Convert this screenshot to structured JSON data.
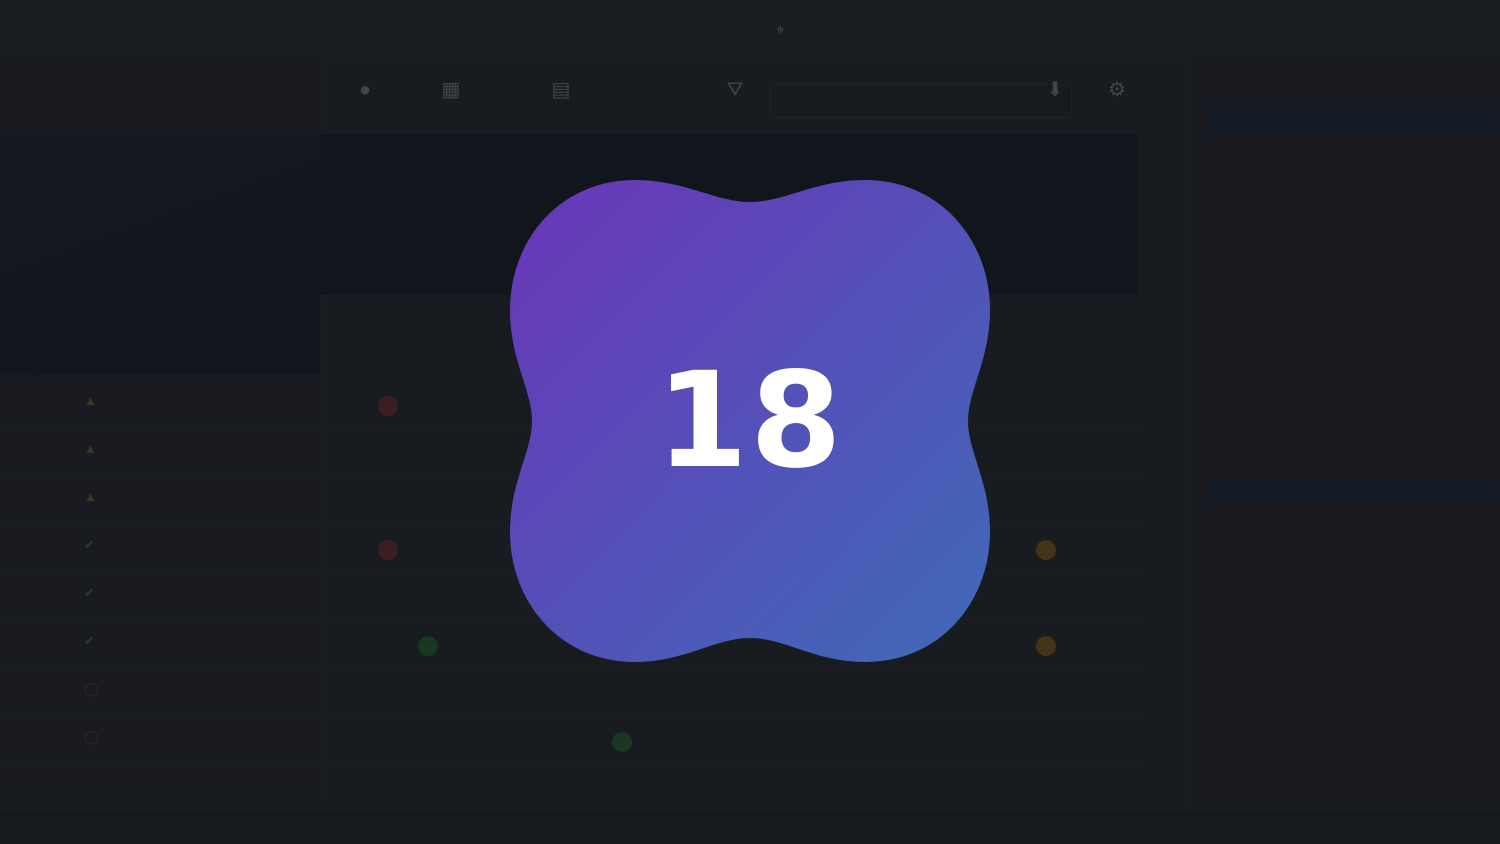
{
  "countdown": {
    "value": "18"
  },
  "colors": {
    "badge_gradient_start": "#6a35b8",
    "badge_gradient_end": "#3f6bb8",
    "overlay": "rgba(18,20,24,0.74)"
  }
}
